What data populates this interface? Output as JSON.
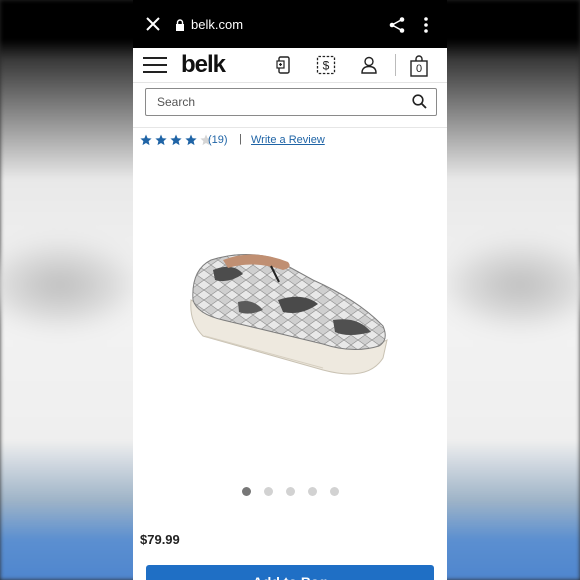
{
  "browser": {
    "url": "belk.com"
  },
  "header": {
    "logo": "belk",
    "bag_count": "0"
  },
  "search": {
    "placeholder": "Search"
  },
  "product": {
    "rating": 4,
    "rating_max": 5,
    "review_count": "(19)",
    "separator": "|",
    "write_review": "Write a Review",
    "price": "$79.99",
    "image_count": 5,
    "active_image": 1,
    "add_to_bag": "Add to Bag"
  },
  "colors": {
    "brand_blue": "#1f6fc5",
    "star_blue": "#1f64a6",
    "link_blue": "#1f64a6"
  },
  "icons": [
    "close-icon",
    "lock-icon",
    "share-icon",
    "more-vert-icon",
    "hamburger-icon",
    "mobile-app-icon",
    "dollar-deals-icon",
    "account-icon",
    "bag-icon",
    "search-icon"
  ]
}
